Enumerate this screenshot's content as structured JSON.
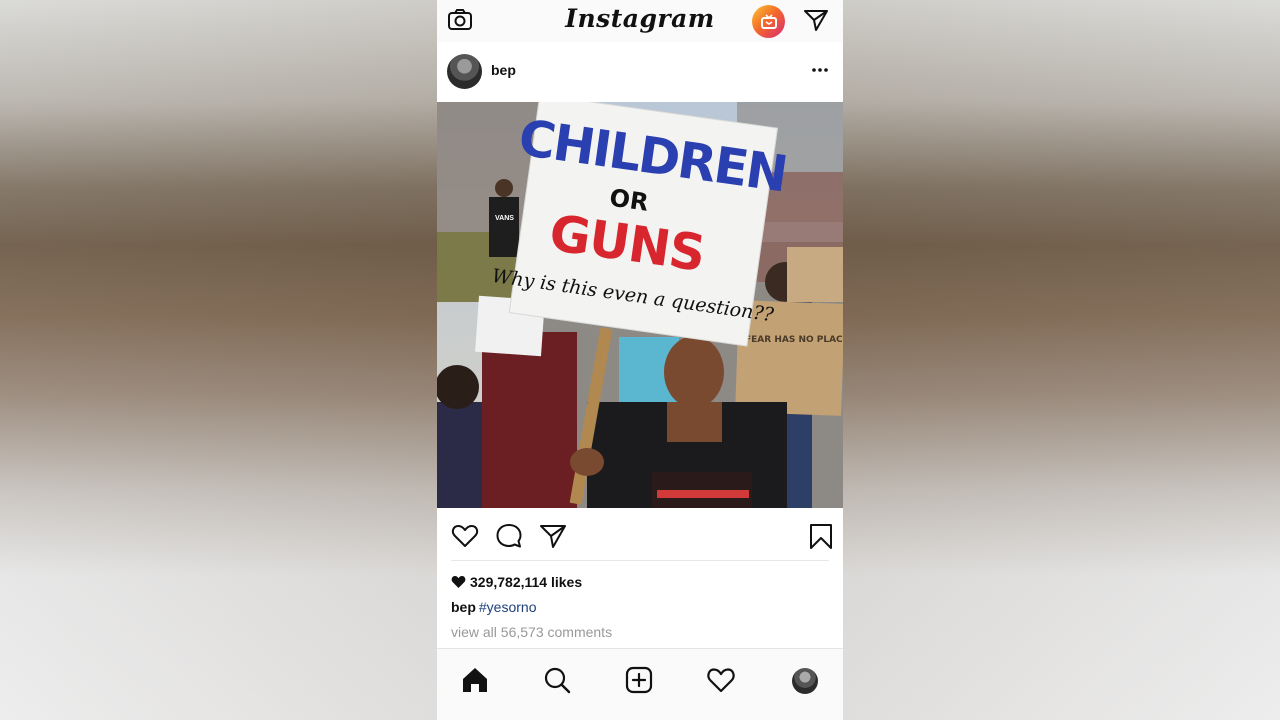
{
  "app": {
    "name": "Instagram"
  },
  "topbar": {
    "logo_text": "Instagram",
    "camera_icon": "camera-icon",
    "igtv_icon": "igtv-icon",
    "direct_icon": "paper-plane-icon"
  },
  "post": {
    "username": "bep",
    "more_icon": "more-options-icon",
    "image_sign_text": {
      "line1": "CHILDREN",
      "line2": "OR",
      "line3": "GUNS",
      "line4": "Why is this even a question??",
      "sign2": "FEAR HAS NO PLACE IN SCHOOL",
      "shirt_text": "VANS"
    },
    "likes_text": "329,782,114 likes",
    "caption_user": "bep",
    "caption_hashtag": "#yesorno",
    "comments_link": "view all 56,573 comments"
  },
  "actions": {
    "like_icon": "heart-icon",
    "comment_icon": "comment-icon",
    "share_icon": "paper-plane-icon",
    "save_icon": "bookmark-icon"
  },
  "bottom_nav": {
    "items": [
      "home-icon",
      "search-icon",
      "add-post-icon",
      "activity-heart-icon",
      "profile-avatar"
    ]
  },
  "colors": {
    "sign_blue": "#2a3fb0",
    "sign_red": "#d8262e",
    "hashtag": "#1e3f7a",
    "muted_text": "#999999"
  }
}
